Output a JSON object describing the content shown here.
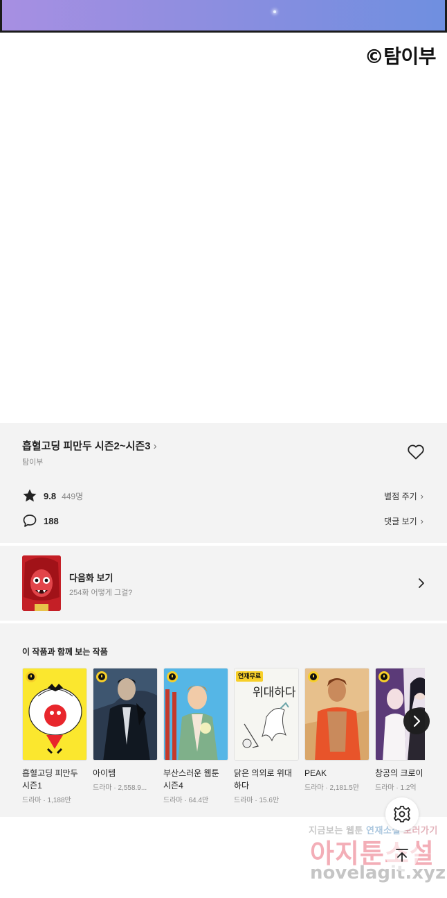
{
  "comic": {
    "copyright": "©탐이부"
  },
  "series": {
    "title": "흡혈고딩 피만두 시즌2~시즌3",
    "title_chevron": "›",
    "author": "탐이부",
    "rating": "9.8",
    "rating_count": "449명",
    "rate_link": "별점 주기",
    "comment_count": "188",
    "comment_link": "댓글 보기"
  },
  "next_episode": {
    "title": "다음화 보기",
    "subtitle": "254화 어떻게 그걸?",
    "thumb_color": "#c41f26"
  },
  "recommendations": {
    "heading": "이 작품과 함께 보는 작품",
    "items": [
      {
        "title_line1": "흡혈고딩 피만두",
        "title_line2": "시즌1",
        "meta": "드라마 · 1,188만",
        "badge": "clock",
        "cover_color": "#fbe72e"
      },
      {
        "title_line1": "아이템",
        "title_line2": "",
        "meta": "드라마 · 2,558.9...",
        "badge": "clock",
        "cover_color": "#1d2a3c"
      },
      {
        "title_line1": "부산스러운 웹툰",
        "title_line2": "시즌4",
        "meta": "드라마 · 64.4만",
        "badge": "clock",
        "cover_color": "#55b6e6"
      },
      {
        "title_line1": "닭은 의외로 위대",
        "title_line2": "하다",
        "meta": "드라마 · 15.6만",
        "badge": "free",
        "badge_text": "연재무료",
        "cover_text": "위대하다",
        "cover_color": "#f6f6f2"
      },
      {
        "title_line1": "PEAK",
        "title_line2": "",
        "meta": "드라마 · 2,181.5만",
        "badge": "clock",
        "cover_color": "#d9a66a"
      },
      {
        "title_line1": "창공의 크로이",
        "title_line2": "",
        "meta": "드라마 · 1.2억",
        "badge": "clock",
        "cover_color": "#cbb6d8"
      }
    ]
  },
  "watermark": {
    "line1_a": "지금보는",
    "line1_b": "웹툰",
    "line1_c": "연재소설",
    "line1_d": "보러가기",
    "line2": "아지툰소설",
    "line3": "novelagit.xyz"
  },
  "colors": {
    "panel_bg": "#f3f3f3",
    "strip_start": "#a78fe2",
    "strip_end": "#6f8fe0",
    "badge_yellow": "#f7cf29"
  }
}
